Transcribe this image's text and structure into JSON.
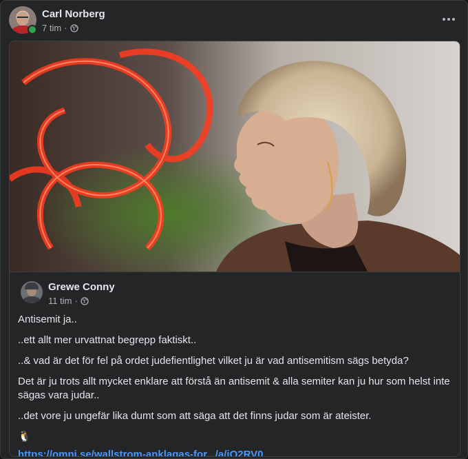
{
  "post": {
    "author": "Carl Norberg",
    "time": "7 tim",
    "separator": "·",
    "privacy_icon": "globe-icon",
    "more_icon": "more-options-icon",
    "online": true
  },
  "shared_post": {
    "author": "Grewe Conny",
    "time": "11 tim",
    "separator": "·",
    "privacy_icon": "globe-icon",
    "paragraphs": [
      "Antisemit ja..",
      "..ett allt mer urvattnat begrepp faktiskt..",
      "..& vad är det för fel på ordet judefientlighet vilket ju är vad  antisemitism sägs betyda?",
      "Det är ju trots allt mycket enklare att förstå än antisemit & alla semiter kan ju hur som helst inte sägas vara judar..",
      "..det vore ju ungefär lika dumt som att säga att det finns judar som är ateister."
    ],
    "emoji": "🐧",
    "link_text": "https://omni.se/wallstrom-anklagas-for.../a/jQ2RV0"
  },
  "colors": {
    "background": "#18191a",
    "card": "#242526",
    "text_primary": "#e4e6eb",
    "text_secondary": "#b0b3b8",
    "link": "#4599ff",
    "online": "#31a24c"
  }
}
